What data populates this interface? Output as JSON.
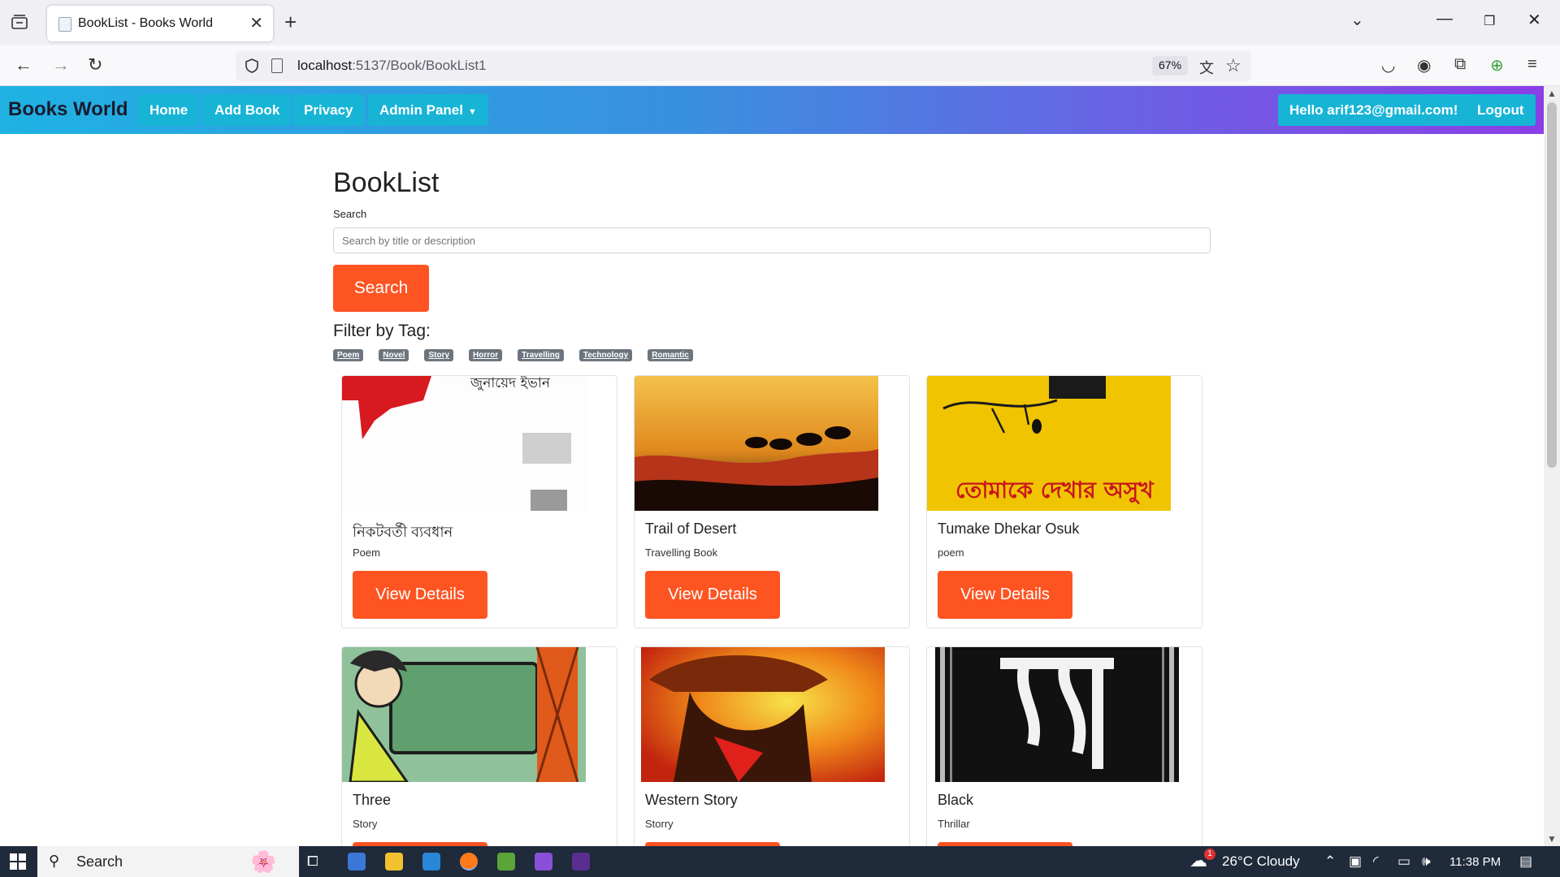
{
  "browser": {
    "tab_title": "BookList - Books World",
    "url_host": "localhost",
    "url_path": ":5137/Book/BookList1",
    "zoom": "67%"
  },
  "navbar": {
    "brand": "Books World",
    "links": [
      "Home",
      "Add Book",
      "Privacy",
      "Admin Panel"
    ],
    "greeting": "Hello arif123@gmail.com!",
    "logout": "Logout"
  },
  "page": {
    "title": "BookList",
    "search_label": "Search",
    "search_placeholder": "Search by title or description",
    "search_button": "Search",
    "filter_label": "Filter by Tag:",
    "tags": [
      "Poem",
      "Novel",
      "Story",
      "Horror",
      "Travelling",
      "Technology",
      "Romantic"
    ]
  },
  "books": [
    {
      "title": "নিকটবর্তী ব্যবধান",
      "tag": "Poem",
      "cover_text": "জুনায়েদ ইভান",
      "cover_colors": [
        "#ffffff",
        "#d71920"
      ]
    },
    {
      "title": "Trail of Desert",
      "tag": "Travelling Book",
      "cover_text": "",
      "cover_colors": [
        "#f2b000",
        "#b5341a"
      ]
    },
    {
      "title": "Tumake Dhekar Osuk",
      "tag": "poem",
      "cover_text": "তোমাকে দেখার অসুখ",
      "cover_colors": [
        "#f0c400",
        "#c8151f"
      ]
    },
    {
      "title": "Three",
      "tag": "Story",
      "cover_text": "",
      "cover_colors": [
        "#5fa06e",
        "#e05a1c"
      ]
    },
    {
      "title": "Western Story",
      "tag": "Storry",
      "cover_text": "",
      "cover_colors": [
        "#e84a14",
        "#f7d21c"
      ]
    },
    {
      "title": "Black",
      "tag": "Thrillar",
      "cover_text": "",
      "cover_colors": [
        "#111111",
        "#ffffff"
      ]
    }
  ],
  "view_details_label": "View Details",
  "taskbar": {
    "search": "Search",
    "weather": "26°C  Cloudy",
    "time": "11:38 PM",
    "weather_badge": "1"
  }
}
